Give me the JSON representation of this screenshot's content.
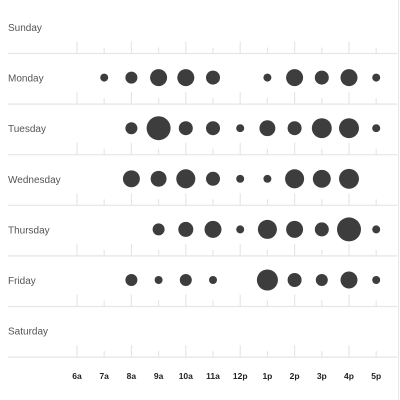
{
  "chart_data": {
    "type": "scatter",
    "subtype": "punch-card",
    "title": "",
    "xlabel": "",
    "ylabel": "",
    "days": [
      "Sunday",
      "Monday",
      "Tuesday",
      "Wednesday",
      "Thursday",
      "Friday",
      "Saturday"
    ],
    "hours": [
      "6a",
      "7a",
      "8a",
      "9a",
      "10a",
      "11a",
      "12p",
      "1p",
      "2p",
      "3p",
      "4p",
      "5p"
    ],
    "max_value": 100,
    "values": [
      [
        0,
        0,
        0,
        0,
        0,
        0,
        0,
        0,
        0,
        0,
        0,
        0
      ],
      [
        0,
        11,
        25,
        50,
        50,
        34,
        0,
        11,
        50,
        34,
        50,
        11
      ],
      [
        0,
        0,
        25,
        100,
        34,
        34,
        11,
        44,
        34,
        69,
        69,
        11
      ],
      [
        0,
        0,
        50,
        44,
        63,
        34,
        11,
        11,
        63,
        56,
        69,
        0
      ],
      [
        0,
        0,
        0,
        25,
        39,
        50,
        11,
        63,
        50,
        34,
        100,
        11
      ],
      [
        0,
        0,
        25,
        11,
        25,
        11,
        0,
        77,
        34,
        25,
        50,
        11
      ],
      [
        0,
        0,
        0,
        0,
        0,
        0,
        0,
        0,
        0,
        0,
        0,
        0
      ]
    ],
    "grid": false,
    "colors": {
      "dot": "#3d3d3d",
      "line": "#e6e6e6",
      "day_label": "#555555",
      "hour_label": "#222222"
    }
  }
}
